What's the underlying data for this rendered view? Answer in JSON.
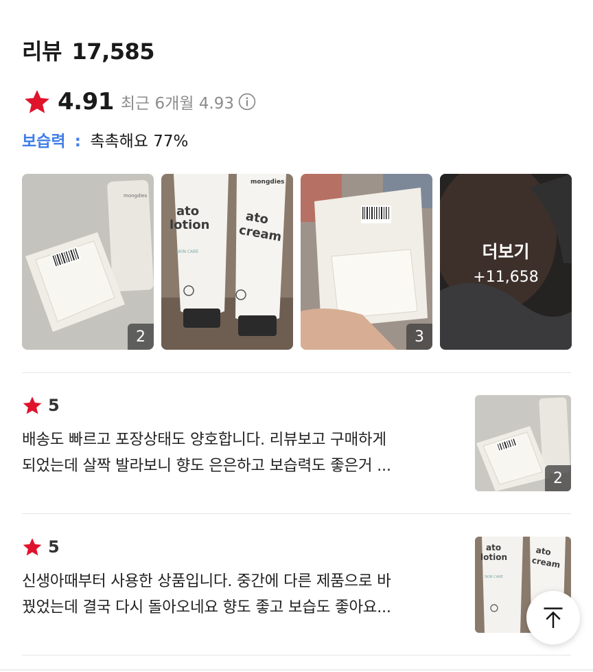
{
  "header": {
    "title": "리뷰",
    "count": "17,585"
  },
  "rating": {
    "score": "4.91",
    "recent_label": "최근 6개월",
    "recent_score": "4.93",
    "star_color": "#e0132c"
  },
  "moisture": {
    "label": "보습력",
    "colon": ":",
    "value": "촉촉해요 77%",
    "accent": "#3f7ee8"
  },
  "gallery": {
    "items": [
      {
        "badge": "2",
        "icon": "product-box-photo"
      },
      {
        "badge": "",
        "icon": "lotion-cream-tubes-photo"
      },
      {
        "badge": "3",
        "icon": "open-box-photo"
      }
    ],
    "more": {
      "label": "더보기",
      "count": "+11,658"
    }
  },
  "reviews": [
    {
      "score": "5",
      "lines": [
        "배송도 빠르고 포장상태도 양호합니다. 리뷰보고 구매하게",
        "되었는데 살짝 발라보니 향도 은은하고 보습력도 좋은거 ..."
      ],
      "badge": "2"
    },
    {
      "score": "5",
      "lines": [
        "신생아때부터 사용한 상품입니다. 중간에 다른 제품으로 바",
        "꿨었는데 결국 다시 돌아오네요 향도 좋고 보습도 좋아요..."
      ],
      "badge": ""
    }
  ],
  "product_text": {
    "brand": "mongdies",
    "lotion_1": "ato",
    "lotion_2": "lotion",
    "cream_1": "ato",
    "cream_2": "cream",
    "skin_care": "SKIN CARE"
  }
}
